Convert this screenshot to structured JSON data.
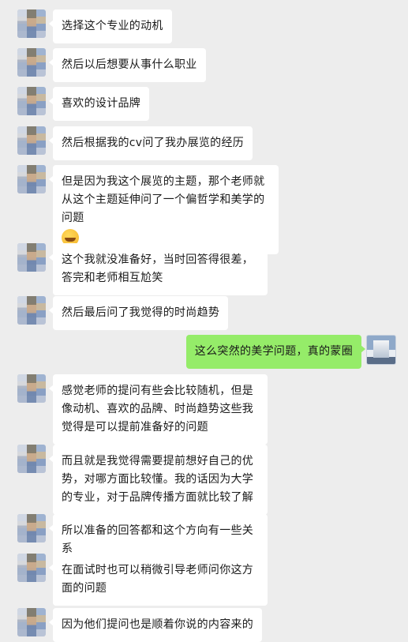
{
  "messages": [
    {
      "side": "left",
      "text": "选择这个专业的动机"
    },
    {
      "side": "left",
      "text": "然后以后想要从事什么职业"
    },
    {
      "side": "left",
      "text": "喜欢的设计品牌"
    },
    {
      "side": "left",
      "text": "然后根据我的cv问了我办展览的经历"
    },
    {
      "side": "left",
      "text": "但是因为我这个展览的主题，那个老师就从这个主题延伸问了一个偏哲学和美学的问题",
      "emoji": "grinning-sweat-emoji"
    },
    {
      "side": "left",
      "text": "这个我就没准备好，当时回答得很差，答完和老师相互尬笑"
    },
    {
      "side": "left",
      "text": "然后最后问了我觉得的时尚趋势"
    },
    {
      "side": "right",
      "text": "这么突然的美学问题，真的蒙圈"
    },
    {
      "side": "left",
      "text": "感觉老师的提问有些会比较随机，但是像动机、喜欢的品牌、时尚趋势这些我觉得是可以提前准备好的问题"
    },
    {
      "side": "left",
      "text": "而且就是我觉得需要提前想好自己的优势，对哪方面比较懂。我的话因为大学的专业，对于品牌传播方面就比较了解"
    },
    {
      "side": "left",
      "text": "所以准备的回答都和这个方向有一些关系"
    },
    {
      "side": "left",
      "text": "在面试时也可以稍微引导老师问你这方面的问题"
    },
    {
      "side": "left",
      "text": "因为他们提问也是顺着你说的内容来的"
    }
  ],
  "colors": {
    "background": "#ededed",
    "bubble_in": "#ffffff",
    "bubble_out": "#95ec69"
  }
}
